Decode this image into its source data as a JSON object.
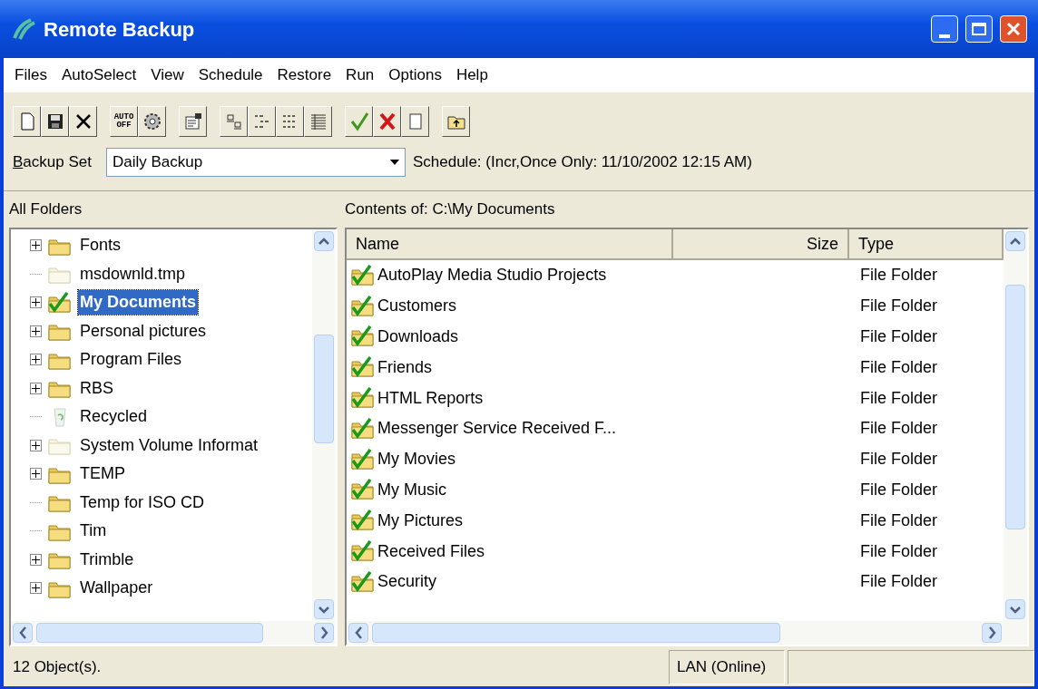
{
  "window": {
    "title": "Remote Backup"
  },
  "menu": [
    "Files",
    "AutoSelect",
    "View",
    "Schedule",
    "Restore",
    "Run",
    "Options",
    "Help"
  ],
  "toolbar": [
    [
      {
        "kind": "new"
      },
      {
        "kind": "save"
      },
      {
        "kind": "delete"
      }
    ],
    [
      {
        "kind": "auto",
        "label": "AUTO OFF"
      },
      {
        "kind": "gear"
      }
    ],
    [
      {
        "kind": "properties"
      }
    ],
    [
      {
        "kind": "large-icons"
      },
      {
        "kind": "small-icons"
      },
      {
        "kind": "list"
      },
      {
        "kind": "details"
      }
    ],
    [
      {
        "kind": "check"
      },
      {
        "kind": "uncheck"
      },
      {
        "kind": "blank"
      }
    ],
    [
      {
        "kind": "up"
      }
    ]
  ],
  "backup_set": {
    "label": "Backup Set",
    "value": "Daily Backup",
    "schedule": "Schedule: (Incr,Once Only: 11/10/2002  12:15 AM)"
  },
  "folders_pane": {
    "title": "All Folders",
    "items": [
      {
        "name": "Fonts",
        "kind": "folder",
        "expandable": true,
        "checked": false,
        "hidden": false,
        "selected": false
      },
      {
        "name": "msdownld.tmp",
        "kind": "folder",
        "expandable": false,
        "checked": false,
        "hidden": true,
        "selected": false
      },
      {
        "name": "My Documents",
        "kind": "folder",
        "expandable": true,
        "checked": true,
        "hidden": false,
        "selected": true
      },
      {
        "name": "Personal pictures",
        "kind": "folder",
        "expandable": true,
        "checked": false,
        "hidden": false,
        "selected": false
      },
      {
        "name": "Program Files",
        "kind": "folder",
        "expandable": true,
        "checked": false,
        "hidden": false,
        "selected": false
      },
      {
        "name": "RBS",
        "kind": "folder",
        "expandable": true,
        "checked": false,
        "hidden": false,
        "selected": false
      },
      {
        "name": "Recycled",
        "kind": "recycle",
        "expandable": false,
        "checked": false,
        "hidden": true,
        "selected": false
      },
      {
        "name": "System Volume Informat",
        "kind": "folder",
        "expandable": true,
        "checked": false,
        "hidden": true,
        "selected": false
      },
      {
        "name": "TEMP",
        "kind": "folder",
        "expandable": true,
        "checked": false,
        "hidden": false,
        "selected": false
      },
      {
        "name": "Temp for ISO CD",
        "kind": "folder",
        "expandable": false,
        "checked": false,
        "hidden": false,
        "selected": false
      },
      {
        "name": "Tim",
        "kind": "folder",
        "expandable": false,
        "checked": false,
        "hidden": false,
        "selected": false
      },
      {
        "name": "Trimble",
        "kind": "folder",
        "expandable": true,
        "checked": false,
        "hidden": false,
        "selected": false
      },
      {
        "name": "Wallpaper",
        "kind": "folder",
        "expandable": true,
        "checked": false,
        "hidden": false,
        "selected": false
      }
    ]
  },
  "contents_pane": {
    "title": "Contents of: C:\\My Documents",
    "columns": [
      "Name",
      "Size",
      "Type"
    ],
    "rows": [
      {
        "name": "AutoPlay Media Studio Projects",
        "type": "File Folder",
        "checked": true
      },
      {
        "name": "Customers",
        "type": "File Folder",
        "checked": true
      },
      {
        "name": "Downloads",
        "type": "File Folder",
        "checked": true
      },
      {
        "name": "Friends",
        "type": "File Folder",
        "checked": true
      },
      {
        "name": "HTML Reports",
        "type": "File Folder",
        "checked": true
      },
      {
        "name": "Messenger Service Received F...",
        "type": "File Folder",
        "checked": true
      },
      {
        "name": "My Movies",
        "type": "File Folder",
        "checked": true
      },
      {
        "name": "My Music",
        "type": "File Folder",
        "checked": true
      },
      {
        "name": "My Pictures",
        "type": "File Folder",
        "checked": true
      },
      {
        "name": "Received Files",
        "type": "File Folder",
        "checked": true
      },
      {
        "name": "Security",
        "type": "File Folder",
        "checked": true
      }
    ]
  },
  "status_bar": [
    "12 Object(s).",
    "LAN (Online)"
  ]
}
